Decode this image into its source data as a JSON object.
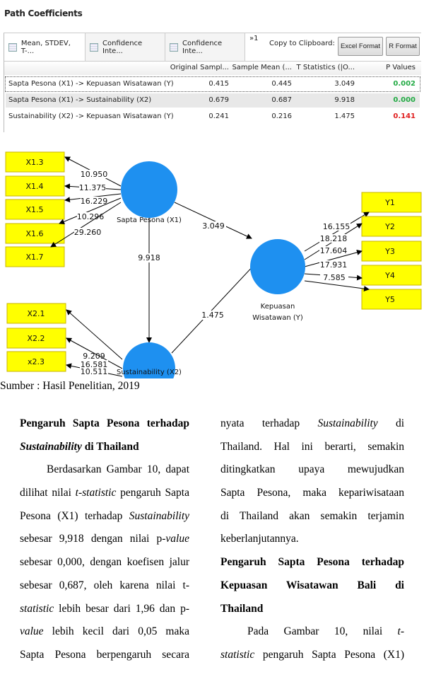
{
  "table": {
    "title": "Path Coefficients",
    "tabs": [
      "Mean, STDEV, T-...",
      "Confidence Inte...",
      "Confidence Inte..."
    ],
    "overflow": "»1",
    "copy_label": "Copy to Clipboard:",
    "buttons": [
      "Excel Format",
      "R Format"
    ],
    "columns": [
      "Original Sampl...",
      "Sample Mean (...",
      "T Statistics (|O...",
      "P Values"
    ],
    "rows": [
      {
        "path": "Sapta Pesona (X1) -> Kepuasan Wisatawan (Y)",
        "original": "0.415",
        "mean": "0.445",
        "t": "3.049",
        "p": "0.002",
        "p_color": "#22aa44"
      },
      {
        "path": "Sapta Pesona (X1) -> Sustainability (X2)",
        "original": "0.679",
        "mean": "0.687",
        "t": "9.918",
        "p": "0.000",
        "p_color": "#22aa44"
      },
      {
        "path": "Sustainability (X2) -> Kepuasan Wisatawan (Y)",
        "original": "0.241",
        "mean": "0.216",
        "t": "1.475",
        "p": "0.141",
        "p_color": "#e02020"
      }
    ]
  },
  "diagram": {
    "constructs": {
      "x1": "Sapta Pesona (X1)",
      "x2": "Sustainability (X2)",
      "y1": "Kepuasan",
      "y2": "Wisatawan (Y)"
    },
    "x1_indicators": [
      {
        "name": "X1.3",
        "t": "10.950"
      },
      {
        "name": "X1.4",
        "t": "11.375"
      },
      {
        "name": "X1.5",
        "t": "16.229"
      },
      {
        "name": "X1.6",
        "t": "10.296"
      },
      {
        "name": "X1.7",
        "t": "29.260"
      }
    ],
    "x2_indicators": [
      {
        "name": "X2.1",
        "t": "9.209"
      },
      {
        "name": "X2.2",
        "t": "16.581"
      },
      {
        "name": "x2.3",
        "t": "10.511"
      }
    ],
    "y_indicators": [
      {
        "name": "Y1",
        "t": "16.155"
      },
      {
        "name": "Y2",
        "t": "18.218"
      },
      {
        "name": "Y3",
        "t": "17.604"
      },
      {
        "name": "Y4",
        "t": "17.931"
      },
      {
        "name": "Y5",
        "t": "7.585"
      }
    ],
    "paths": {
      "x1_y": "3.049",
      "x1_x2": "9.918",
      "x2_y": "1.475"
    },
    "colors": {
      "construct": "#1e90f0",
      "indicator": "#ffff00"
    }
  },
  "caption": "Sumber : Hasil Penelitian, 2019",
  "left_column": [
    {
      "b": 1,
      "s": [
        [
          "Pengaruh Sapta Pesona terhadap",
          ""
        ]
      ]
    },
    {
      "b": 1,
      "cls": "left",
      "s": [
        [
          "Sustainability",
          "i"
        ],
        [
          " di Thailand",
          ""
        ]
      ]
    },
    {
      "cls": "ind",
      "s": [
        [
          "Berdasarkan Gambar 10, dapat",
          ""
        ]
      ]
    },
    {
      "s": [
        [
          "dilihat nilai ",
          ""
        ],
        [
          "t-statistic",
          "i"
        ],
        [
          " pengaruh Sapta",
          ""
        ]
      ]
    },
    {
      "s": [
        [
          "Pesona (X1) terhadap ",
          ""
        ],
        [
          "Sustainability",
          "i"
        ]
      ]
    },
    {
      "s": [
        [
          "sebesar 9,918 dengan nilai p-",
          ""
        ],
        [
          "value",
          "i"
        ]
      ]
    },
    {
      "s": [
        [
          "sebesar 0,000, dengan koefisen jalur",
          ""
        ]
      ]
    },
    {
      "s": [
        [
          "sebesar 0,687, oleh karena nilai t-",
          ""
        ]
      ]
    },
    {
      "s": [
        [
          "statistic",
          "i"
        ],
        [
          " lebih besar dari 1,96 dan p-",
          ""
        ]
      ]
    },
    {
      "s": [
        [
          "value",
          "i"
        ],
        [
          " lebih kecil dari 0,05 maka",
          ""
        ]
      ]
    },
    {
      "s": [
        [
          "Sapta Pesona berpengaruh secara",
          ""
        ]
      ]
    }
  ],
  "right_column": [
    {
      "s": [
        [
          "nyata terhadap ",
          ""
        ],
        [
          "Sustainability",
          "i"
        ],
        [
          " di",
          ""
        ]
      ]
    },
    {
      "s": [
        [
          "Thailand. Hal ini berarti, semakin",
          ""
        ]
      ]
    },
    {
      "s": [
        [
          "ditingkatkan upaya mewujudkan",
          ""
        ]
      ]
    },
    {
      "s": [
        [
          "Sapta Pesona, maka kepariwisataan",
          ""
        ]
      ]
    },
    {
      "s": [
        [
          "di Thailand akan semakin terjamin",
          ""
        ]
      ]
    },
    {
      "cls": "left",
      "s": [
        [
          "keberlanjutannya.",
          ""
        ]
      ]
    },
    {
      "b": 1,
      "s": [
        [
          "Pengaruh Sapta Pesona terhadap",
          ""
        ]
      ]
    },
    {
      "b": 1,
      "s": [
        [
          "Kepuasan Wisatawan Bali di",
          ""
        ]
      ]
    },
    {
      "b": 1,
      "cls": "left",
      "s": [
        [
          "Thailand",
          ""
        ]
      ]
    },
    {
      "cls": "ind",
      "s": [
        [
          "Pada Gambar 10, nilai ",
          ""
        ],
        [
          "t-",
          "i"
        ]
      ]
    },
    {
      "s": [
        [
          "statistic",
          "i"
        ],
        [
          " pengaruh Sapta Pesona (X1)",
          ""
        ]
      ]
    }
  ]
}
